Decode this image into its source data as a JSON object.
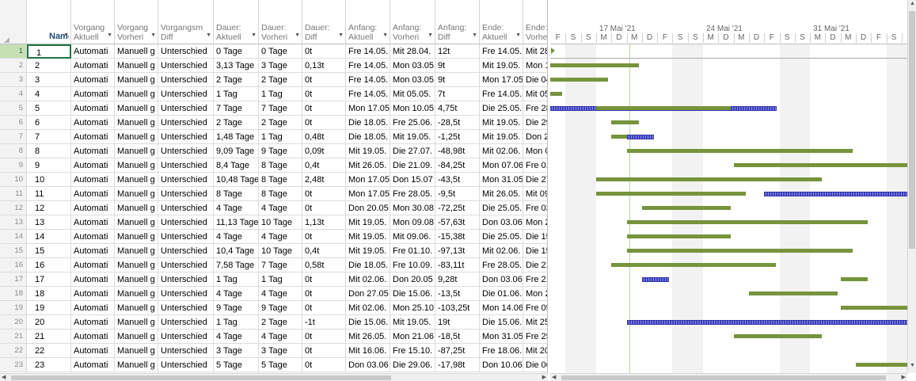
{
  "columns": [
    {
      "key": "name",
      "line1": "",
      "line2": "Name"
    },
    {
      "key": "c1",
      "line1": "Vorgang",
      "line2": "Aktuell"
    },
    {
      "key": "c2",
      "line1": "Vorgang",
      "line2": "Vorheri"
    },
    {
      "key": "c3",
      "line1": "Vorgangsm",
      "line2": "Diff"
    },
    {
      "key": "c4",
      "line1": "Dauer:",
      "line2": "Aktuell"
    },
    {
      "key": "c5",
      "line1": "Dauer:",
      "line2": "Vorheri"
    },
    {
      "key": "c6",
      "line1": "Dauer:",
      "line2": "Diff"
    },
    {
      "key": "c7",
      "line1": "Anfang:",
      "line2": "Aktuell"
    },
    {
      "key": "c8",
      "line1": "Anfang:",
      "line2": "Vorheri"
    },
    {
      "key": "c9",
      "line1": "Anfang:",
      "line2": "Diff"
    },
    {
      "key": "c10",
      "line1": "Ende:",
      "line2": "Aktuell"
    },
    {
      "key": "c11",
      "line1": "Ende:",
      "line2": "Vorheri"
    }
  ],
  "rows": [
    {
      "id": "1",
      "name": "1",
      "c1": "Automati",
      "c2": "Manuell g",
      "c3": "Unterschied",
      "c4": "0 Tage",
      "c5": "0 Tage",
      "c6": "0t",
      "c7": "Fre 14.05.",
      "c8": "Mit 28.04.",
      "c9": "12t",
      "c10": "Fre 14.05.",
      "c11": "Mit 28"
    },
    {
      "id": "2",
      "name": "2",
      "c1": "Automati",
      "c2": "Manuell g",
      "c3": "Unterschied",
      "c4": "3,13 Tage",
      "c5": "3 Tage",
      "c6": "0,13t",
      "c7": "Fre 14.05.",
      "c8": "Mon 03.05",
      "c9": "9t",
      "c10": "Mit 19.05.",
      "c11": "Mon 1"
    },
    {
      "id": "3",
      "name": "3",
      "c1": "Automati",
      "c2": "Manuell g",
      "c3": "Unterschied",
      "c4": "2 Tage",
      "c5": "2 Tage",
      "c6": "0t",
      "c7": "Fre 14.05.",
      "c8": "Mon 03.05",
      "c9": "9t",
      "c10": "Mon 17.05",
      "c11": "Die 04"
    },
    {
      "id": "4",
      "name": "4",
      "c1": "Automati",
      "c2": "Manuell g",
      "c3": "Unterschied",
      "c4": "1 Tag",
      "c5": "1 Tag",
      "c6": "0t",
      "c7": "Fre 14.05.",
      "c8": "Mit 05.05.",
      "c9": "7t",
      "c10": "Fre 14.05.",
      "c11": "Mit 05"
    },
    {
      "id": "5",
      "name": "5",
      "c1": "Automati",
      "c2": "Manuell g",
      "c3": "Unterschied",
      "c4": "7 Tage",
      "c5": "7 Tage",
      "c6": "0t",
      "c7": "Mon 17.05",
      "c8": "Mon 10.05",
      "c9": "4,75t",
      "c10": "Die 25.05.",
      "c11": "Fre 28"
    },
    {
      "id": "6",
      "name": "6",
      "c1": "Automati",
      "c2": "Manuell g",
      "c3": "Unterschied",
      "c4": "2 Tage",
      "c5": "2 Tage",
      "c6": "0t",
      "c7": "Die 18.05.",
      "c8": "Fre 25.06.",
      "c9": "-28,5t",
      "c10": "Mit 19.05.",
      "c11": "Die 29"
    },
    {
      "id": "7",
      "name": "7",
      "c1": "Automati",
      "c2": "Manuell g",
      "c3": "Unterschied",
      "c4": "1,48 Tage",
      "c5": "1 Tag",
      "c6": "0,48t",
      "c7": "Die 18.05.",
      "c8": "Mit 19.05.",
      "c9": "-1,25t",
      "c10": "Mit 19.05.",
      "c11": "Don 2"
    },
    {
      "id": "8",
      "name": "8",
      "c1": "Automati",
      "c2": "Manuell g",
      "c3": "Unterschied",
      "c4": "9,09 Tage",
      "c5": "9 Tage",
      "c6": "0,09t",
      "c7": "Mit 19.05.",
      "c8": "Die 27.07.",
      "c9": "-48,98t",
      "c10": "Mit 02.06.",
      "c11": "Mon 0"
    },
    {
      "id": "9",
      "name": "9",
      "c1": "Automati",
      "c2": "Manuell g",
      "c3": "Unterschied",
      "c4": "8,4 Tage",
      "c5": "8 Tage",
      "c6": "0,4t",
      "c7": "Mit 26.05.",
      "c8": "Die 21.09.",
      "c9": "-84,25t",
      "c10": "Mon 07.06",
      "c11": "Fre 01"
    },
    {
      "id": "10",
      "name": "10",
      "c1": "Automati",
      "c2": "Manuell g",
      "c3": "Unterschied",
      "c4": "10,48 Tage",
      "c5": "8 Tage",
      "c6": "2,48t",
      "c7": "Mon 17.05",
      "c8": "Don 15.07",
      "c9": "-43,5t",
      "c10": "Mon 31.05",
      "c11": "Die 27"
    },
    {
      "id": "11",
      "name": "11",
      "c1": "Automati",
      "c2": "Manuell g",
      "c3": "Unterschied",
      "c4": "8 Tage",
      "c5": "8 Tage",
      "c6": "0t",
      "c7": "Mon 17.05",
      "c8": "Fre 28.05.",
      "c9": "-9,5t",
      "c10": "Mit 26.05.",
      "c11": "Mit 09"
    },
    {
      "id": "12",
      "name": "12",
      "c1": "Automati",
      "c2": "Manuell g",
      "c3": "Unterschied",
      "c4": "4 Tage",
      "c5": "4 Tage",
      "c6": "0t",
      "c7": "Don 20.05",
      "c8": "Mon 30.08",
      "c9": "-72,25t",
      "c10": "Die 25.05.",
      "c11": "Fre 03"
    },
    {
      "id": "13",
      "name": "13",
      "c1": "Automati",
      "c2": "Manuell g",
      "c3": "Unterschied",
      "c4": "11,13 Tage",
      "c5": "10 Tage",
      "c6": "1,13t",
      "c7": "Mit 19.05.",
      "c8": "Mon 09.08",
      "c9": "-57,63t",
      "c10": "Don 03.06",
      "c11": "Mon 2"
    },
    {
      "id": "14",
      "name": "14",
      "c1": "Automati",
      "c2": "Manuell g",
      "c3": "Unterschied",
      "c4": "4 Tage",
      "c5": "4 Tage",
      "c6": "0t",
      "c7": "Mit 19.05.",
      "c8": "Mit 09.06.",
      "c9": "-15,38t",
      "c10": "Die 25.05.",
      "c11": "Die 15"
    },
    {
      "id": "15",
      "name": "15",
      "c1": "Automati",
      "c2": "Manuell g",
      "c3": "Unterschied",
      "c4": "10,4 Tage",
      "c5": "10 Tage",
      "c6": "0,4t",
      "c7": "Mit 19.05.",
      "c8": "Fre 01.10.",
      "c9": "-97,13t",
      "c10": "Mit 02.06.",
      "c11": "Die 15"
    },
    {
      "id": "16",
      "name": "16",
      "c1": "Automati",
      "c2": "Manuell g",
      "c3": "Unterschied",
      "c4": "7,58 Tage",
      "c5": "7 Tage",
      "c6": "0,58t",
      "c7": "Die 18.05.",
      "c8": "Fre 10.09.",
      "c9": "-83,11t",
      "c10": "Fre 28.05.",
      "c11": "Die 21"
    },
    {
      "id": "17",
      "name": "17",
      "c1": "Automati",
      "c2": "Manuell g",
      "c3": "Unterschied",
      "c4": "1 Tag",
      "c5": "1 Tag",
      "c6": "0t",
      "c7": "Mit 02.06.",
      "c8": "Don 20.05",
      "c9": "9,28t",
      "c10": "Don 03.06",
      "c11": "Fre 21"
    },
    {
      "id": "18",
      "name": "18",
      "c1": "Automati",
      "c2": "Manuell g",
      "c3": "Unterschied",
      "c4": "4 Tage",
      "c5": "4 Tage",
      "c6": "0t",
      "c7": "Don 27.05",
      "c8": "Die 15.06.",
      "c9": "-13,5t",
      "c10": "Die 01.06.",
      "c11": "Mon 2"
    },
    {
      "id": "19",
      "name": "19",
      "c1": "Automati",
      "c2": "Manuell g",
      "c3": "Unterschied",
      "c4": "9 Tage",
      "c5": "9 Tage",
      "c6": "0t",
      "c7": "Mit 02.06.",
      "c8": "Mon 25.10",
      "c9": "-103,25t",
      "c10": "Mon 14.06",
      "c11": "Fre 05"
    },
    {
      "id": "20",
      "name": "20",
      "c1": "Automati",
      "c2": "Manuell g",
      "c3": "Unterschied",
      "c4": "1 Tag",
      "c5": "2 Tage",
      "c6": "-1t",
      "c7": "Die 15.06.",
      "c8": "Mit 19.05.",
      "c9": "19t",
      "c10": "Die 15.06.",
      "c11": "Mit 25"
    },
    {
      "id": "21",
      "name": "21",
      "c1": "Automati",
      "c2": "Manuell g",
      "c3": "Unterschied",
      "c4": "4 Tage",
      "c5": "4 Tage",
      "c6": "0t",
      "c7": "Mit 26.05.",
      "c8": "Mon 21.06",
      "c9": "-18,5t",
      "c10": "Mon 31.05",
      "c11": "Fre 25"
    },
    {
      "id": "22",
      "name": "22",
      "c1": "Automati",
      "c2": "Manuell g",
      "c3": "Unterschied",
      "c4": "3 Tage",
      "c5": "3 Tage",
      "c6": "0t",
      "c7": "Mit 16.06.",
      "c8": "Fre 15.10.",
      "c9": "-87,25t",
      "c10": "Fre 18.06.",
      "c11": "Mit 20"
    },
    {
      "id": "23",
      "name": "23",
      "c1": "Automati",
      "c2": "Manuell g",
      "c3": "Unterschied",
      "c4": "5 Tage",
      "c5": "5 Tage",
      "c6": "0t",
      "c7": "Don 03.06",
      "c8": "Die 29.06.",
      "c9": "-17,98t",
      "c10": "Don 10.06",
      "c11": "Die 06"
    }
  ],
  "timescale": {
    "weeks": [
      "17 Mai '21",
      "24 Mai '21",
      "31 Mai '21"
    ],
    "days": [
      "F",
      "S",
      "S",
      "M",
      "D",
      "M",
      "D",
      "F",
      "S",
      "S",
      "M",
      "D",
      "M",
      "D",
      "F",
      "S",
      "S",
      "M",
      "D",
      "M",
      "D",
      "F",
      "S"
    ]
  },
  "gantt": {
    "start_date": "2021-05-14",
    "milestone_row": 1,
    "bars": [
      {
        "row": 2,
        "start": "2021-05-14",
        "end": "2021-05-19",
        "kind": "normal"
      },
      {
        "row": 3,
        "start": "2021-05-14",
        "end": "2021-05-17",
        "kind": "normal"
      },
      {
        "row": 4,
        "start": "2021-05-14",
        "end": "2021-05-14",
        "kind": "normal"
      },
      {
        "row": 5,
        "start": "2021-05-14",
        "end": "2021-05-28",
        "kind": "hatch"
      },
      {
        "row": 5,
        "start": "2021-05-17",
        "end": "2021-05-25",
        "kind": "normal"
      },
      {
        "row": 6,
        "start": "2021-05-18",
        "end": "2021-05-19",
        "kind": "normal"
      },
      {
        "row": 7,
        "start": "2021-05-18",
        "end": "2021-05-19",
        "kind": "normal"
      },
      {
        "row": 7,
        "start": "2021-05-19",
        "end": "2021-05-20",
        "kind": "hatch"
      },
      {
        "row": 8,
        "start": "2021-05-19",
        "end": "2021-06-02",
        "kind": "normal"
      },
      {
        "row": 9,
        "start": "2021-05-26",
        "end": "2021-06-07",
        "kind": "normal"
      },
      {
        "row": 10,
        "start": "2021-05-17",
        "end": "2021-05-31",
        "kind": "normal"
      },
      {
        "row": 11,
        "start": "2021-05-17",
        "end": "2021-05-26",
        "kind": "normal"
      },
      {
        "row": 11,
        "start": "2021-05-28",
        "end": "2021-06-09",
        "kind": "hatch"
      },
      {
        "row": 12,
        "start": "2021-05-20",
        "end": "2021-05-25",
        "kind": "normal"
      },
      {
        "row": 13,
        "start": "2021-05-19",
        "end": "2021-06-03",
        "kind": "normal"
      },
      {
        "row": 14,
        "start": "2021-05-19",
        "end": "2021-05-25",
        "kind": "normal"
      },
      {
        "row": 15,
        "start": "2021-05-19",
        "end": "2021-06-02",
        "kind": "normal"
      },
      {
        "row": 16,
        "start": "2021-05-18",
        "end": "2021-05-28",
        "kind": "normal"
      },
      {
        "row": 17,
        "start": "2021-05-20",
        "end": "2021-05-21",
        "kind": "hatch"
      },
      {
        "row": 17,
        "start": "2021-06-02",
        "end": "2021-06-03",
        "kind": "normal"
      },
      {
        "row": 18,
        "start": "2021-05-27",
        "end": "2021-06-01",
        "kind": "normal"
      },
      {
        "row": 19,
        "start": "2021-06-02",
        "end": "2021-06-14",
        "kind": "normal"
      },
      {
        "row": 20,
        "start": "2021-05-19",
        "end": "2021-06-25",
        "kind": "hatch"
      },
      {
        "row": 21,
        "start": "2021-05-26",
        "end": "2021-05-31",
        "kind": "normal"
      },
      {
        "row": 23,
        "start": "2021-06-03",
        "end": "2021-06-10",
        "kind": "normal"
      }
    ]
  }
}
